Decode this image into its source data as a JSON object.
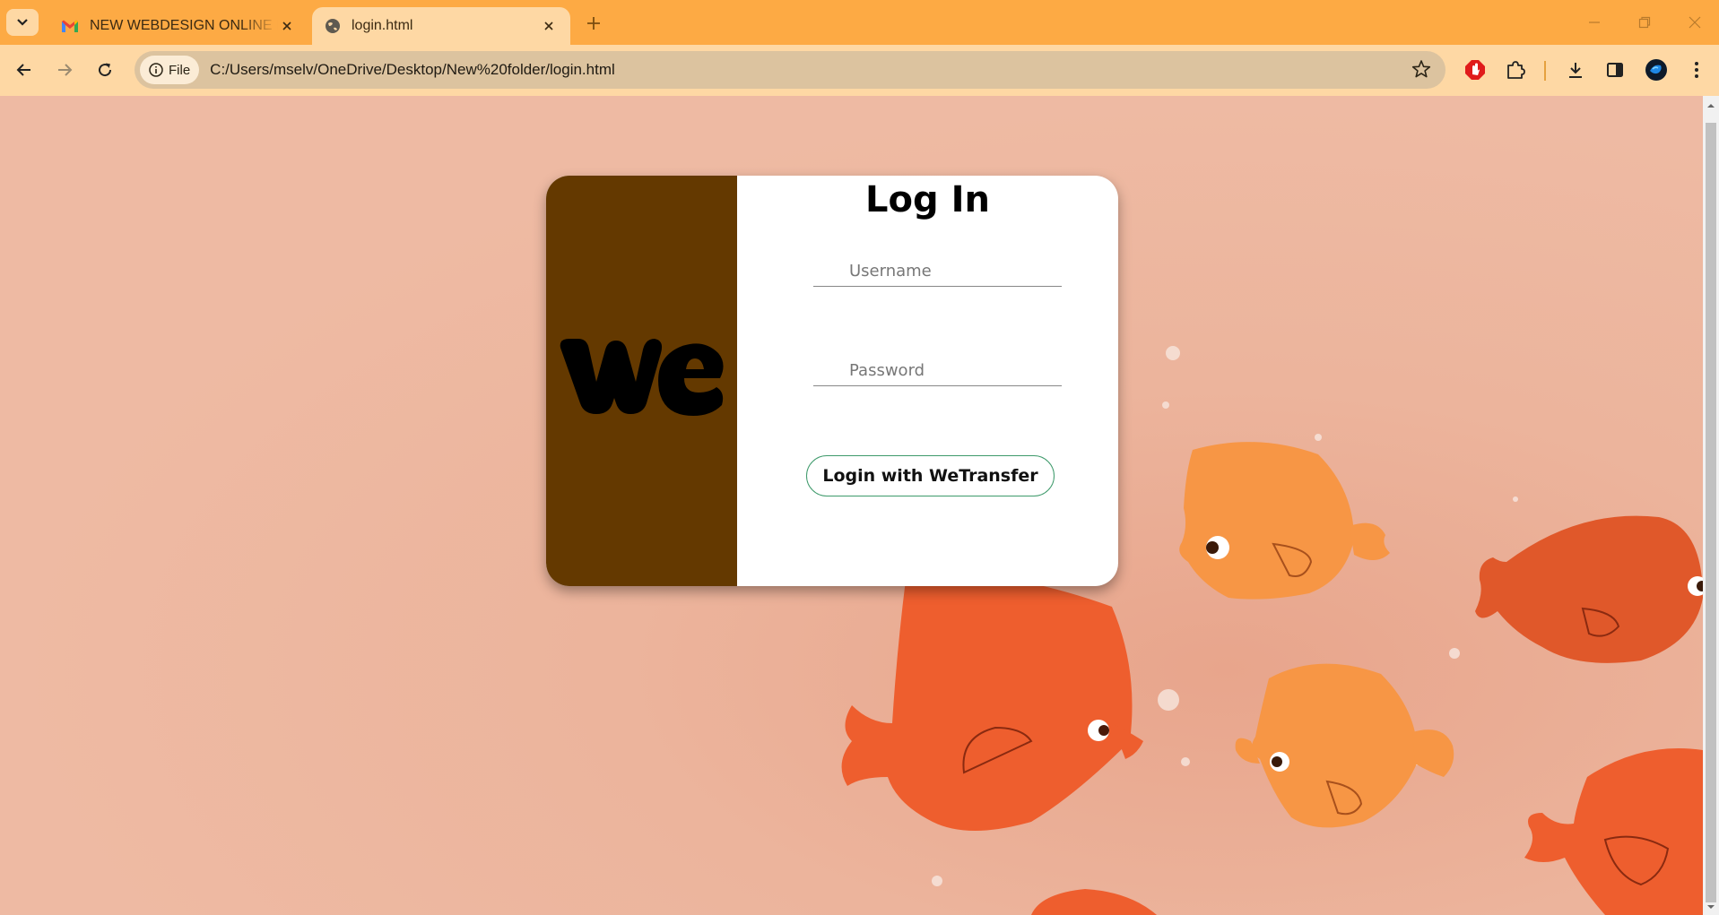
{
  "browser": {
    "tabs": [
      {
        "title": "NEW WEBDESIGN ONLINE INTE",
        "icon": "gmail-icon",
        "active": false
      },
      {
        "title": "login.html",
        "icon": "globe-icon",
        "active": true
      }
    ],
    "address": {
      "scheme_chip": "File",
      "url": "C:/Users/mselv/OneDrive/Desktop/New%20folder/login.html"
    }
  },
  "login_card": {
    "logo_text": "we",
    "title": "Log In",
    "username_placeholder": "Username",
    "password_placeholder": "Password",
    "submit_label": "Login with WeTransfer"
  },
  "colors": {
    "tabbar": "#fdaa44",
    "toolbar": "#fed8a4",
    "page_background": "#ecb8a0",
    "card_left_panel": "#643900",
    "button_border": "#3e9a6b"
  }
}
